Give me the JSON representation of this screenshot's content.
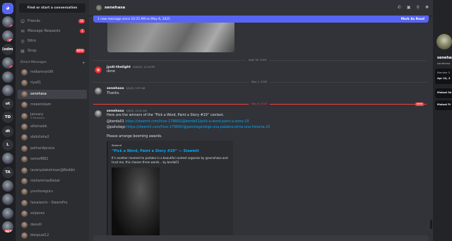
{
  "servers": [
    {
      "label": "",
      "kind": "discord"
    },
    {
      "label": "",
      "kind": "img",
      "badge": "4"
    },
    {
      "label": "",
      "kind": "img",
      "badge": "32"
    },
    {
      "label": "Exdm.",
      "kind": "text"
    },
    {
      "label": "",
      "kind": "img",
      "badge": "2"
    },
    {
      "label": "",
      "kind": "img"
    },
    {
      "label": "",
      "kind": "img"
    },
    {
      "label": "ot",
      "kind": "text"
    },
    {
      "label": "TD",
      "kind": "text"
    },
    {
      "label": "dt",
      "kind": "text"
    },
    {
      "label": "L",
      "kind": "text"
    },
    {
      "label": "",
      "kind": "img"
    },
    {
      "label": "TA",
      "kind": "text"
    },
    {
      "label": "",
      "kind": "img"
    },
    {
      "label": "",
      "kind": "img"
    },
    {
      "label": "",
      "kind": "img"
    },
    {
      "label": "",
      "kind": "img",
      "badge": "NEW"
    }
  ],
  "dm_sidebar": {
    "find_placeholder": "Find or start a conversation",
    "nav": [
      {
        "label": "Friends",
        "icon": "friends-icon",
        "badge": "16"
      },
      {
        "label": "Message Requests",
        "icon": "mail-icon",
        "badge": "1"
      },
      {
        "label": "Nitro",
        "icon": "nitro-icon",
        "badge": ""
      },
      {
        "label": "Shop",
        "icon": "shop-icon",
        "badge": "NEW"
      }
    ],
    "direct_messages_label": "Direct Messages",
    "dms": [
      {
        "name": "mdkamran99",
        "sub": ""
      },
      {
        "name": "riya01",
        "sub": ""
      },
      {
        "name": "senehasa",
        "sub": "",
        "active": true
      },
      {
        "name": "moeenislam",
        "sub": ""
      },
      {
        "name": "January",
        "sub": "3 Members"
      },
      {
        "name": "alfamalek",
        "sub": ""
      },
      {
        "name": "abdullahe2",
        "sub": ""
      },
      {
        "name": "pathanAprana",
        "sub": ""
      },
      {
        "name": "ozma4882",
        "sub": ""
      },
      {
        "name": "lavanyalakshman@Reddin",
        "sub": ""
      },
      {
        "name": "mohammadfaisal",
        "sub": ""
      },
      {
        "name": "yourloveguru",
        "sub": ""
      },
      {
        "name": "faisalamin - SteemPro",
        "sub": ""
      },
      {
        "name": "solperez",
        "sub": ""
      },
      {
        "name": "dasudi",
        "sub": ""
      },
      {
        "name": "blespual12",
        "sub": ""
      }
    ]
  },
  "chat": {
    "header_name": "senehasa",
    "header_icons": [
      "phone-icon",
      "video-icon",
      "pin-icon",
      "add-member-icon"
    ],
    "new_bar_text": "1 new message since 10:25 AM on May 6, 2025",
    "mark_as_read": "Mark As Read",
    "dividers": [
      "April 30, 2025",
      "May 1, 2025",
      "May 6, 2025"
    ],
    "new_tag": "NEW",
    "messages": [
      {
        "author": "jyoti-thelight",
        "time": "4/30/25, 11:20 PM",
        "lines": [
          "done"
        ]
      },
      {
        "author": "senehasa",
        "time": "5/1/25, 5:57 AM",
        "lines": [
          "Thanks."
        ]
      },
      {
        "author": "senehasa",
        "time": "5/6/25, 10:25 AM",
        "intro": "Here are the winners of the “Pick a Word, Paint a Story #19” contest.",
        "w1_user": "@berda01",
        "w1_link": "https://steemit.com/hive-179660/@berda01/pick-a-word-paint-a-story-20",
        "w2_user": "@paholags",
        "w2_link": "https://steemit.com/hive-179660/@paholags/elige-una-palabra-pinta-una-historia-20",
        "closing": "Please arrange booming awards."
      }
    ],
    "embed": {
      "site": "Steemit",
      "title": "“Pick a Word, Paint a Story #20” — Steemit",
      "desc": "It’s another moment to partake in a beautiful contest organize by @senehasa and trust me, this chosen three words... by berda01"
    }
  },
  "profile": {
    "name": "senehasa",
    "username": "senehasa",
    "member_since_label": "Member S",
    "member_since_value": "Apr 24, 2",
    "mutual_servers": "Mutual Se",
    "mutual_friends": "Mutual Fr"
  }
}
